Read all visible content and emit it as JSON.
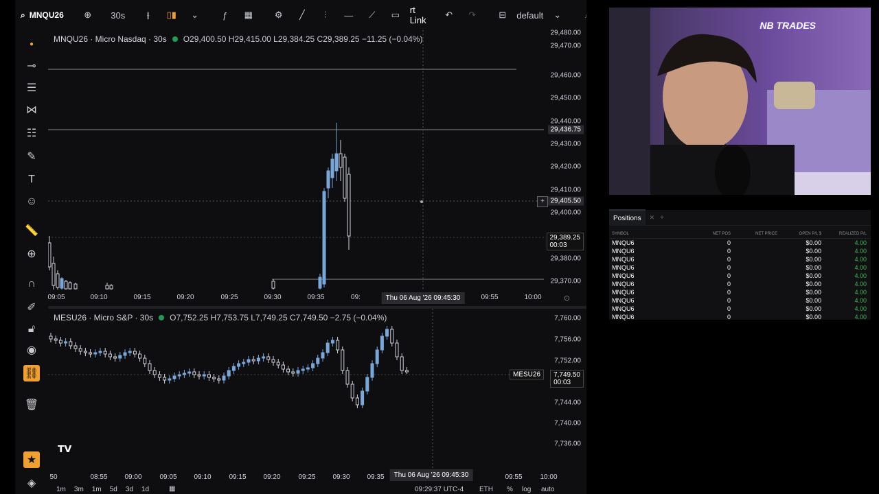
{
  "toolbar": {
    "symbol": "MNQU26",
    "interval": "30s",
    "link_label": "rt Link",
    "layout_name": "default"
  },
  "chart1": {
    "legend_name": "MNQU26 · Micro Nasdaq · 30s",
    "ohlc": "O29,400.50 H29,415.00 L29,384.25 C29,389.25 −11.25 (−0.04%)",
    "price_labels": [
      "29,480.00",
      "29,470.00",
      "29,460.00",
      "29,450.00",
      "29,440.00",
      "29,430.00",
      "29,420.00",
      "29,410.00",
      "29,400.00",
      "29,380.00",
      "29,370.00"
    ],
    "hline_tag": "29,436.75",
    "cursor_tag": "29,405.50",
    "last_price": "29,389.25",
    "last_countdown": "00:03",
    "time_labels": [
      "09:05",
      "09:10",
      "09:15",
      "09:20",
      "09:25",
      "09:30",
      "09:35",
      "09:",
      "09:55",
      "10:00"
    ],
    "cross_time": "Thu 06 Aug '26   09:45:30"
  },
  "chart2": {
    "legend_name": "MESU26 · Micro S&P · 30s",
    "ohlc": "O7,752.25 H7,753.75 L7,749.25 C7,749.50 −2.75 (−0.04%)",
    "price_labels": [
      "7,760.00",
      "7,756.00",
      "7,752.00",
      "7,744.00",
      "7,740.00",
      "7,736.00"
    ],
    "symbol_tag": "MESU26",
    "last_price": "7,749.50",
    "last_countdown": "00:03",
    "time_labels": [
      "50",
      "08:55",
      "09:00",
      "09:05",
      "09:10",
      "09:15",
      "09:20",
      "09:25",
      "09:30",
      "09:35",
      "09:55",
      "10:00"
    ],
    "cross_time": "Thu 06 Aug '26   09:45:30"
  },
  "bottombar": {
    "clock": "09:29:37 UTC-4",
    "session": "ETH",
    "percent": "%",
    "log": "log",
    "auto": "auto",
    "ranges": [
      "1m",
      "3m",
      "1m",
      "5d",
      "3d",
      "1d"
    ]
  },
  "positions": {
    "tab": "Positions",
    "columns": [
      "SYMBOL",
      "NET POS",
      "NET PRICE",
      "OPEN P/L $",
      "REALIZED P/L"
    ],
    "rows": [
      [
        "MNQU6",
        "0",
        "",
        "$0.00",
        "4.00"
      ],
      [
        "MNQU6",
        "0",
        "",
        "$0.00",
        "4.00"
      ],
      [
        "MNQU6",
        "0",
        "",
        "$0.00",
        "4.00"
      ],
      [
        "MNQU6",
        "0",
        "",
        "$0.00",
        "4.00"
      ],
      [
        "MNQU6",
        "0",
        "",
        "$0.00",
        "4.00"
      ],
      [
        "MNQU6",
        "0",
        "",
        "$0.00",
        "4.00"
      ],
      [
        "MNQU6",
        "0",
        "",
        "$0.00",
        "4.00"
      ],
      [
        "MNQU6",
        "0",
        "",
        "$0.00",
        "4.00"
      ],
      [
        "MNQU6",
        "0",
        "",
        "$0.00",
        "4.00"
      ],
      [
        "MNQU6",
        "0",
        "",
        "$0.00",
        "4.00"
      ]
    ]
  },
  "webcam": {
    "logo_text": "NB TRADES"
  },
  "colors": {
    "bull": "#7aa7d9",
    "bear": "#d1d4dc",
    "background": "#0e0e10",
    "profit": "#3fb950"
  }
}
